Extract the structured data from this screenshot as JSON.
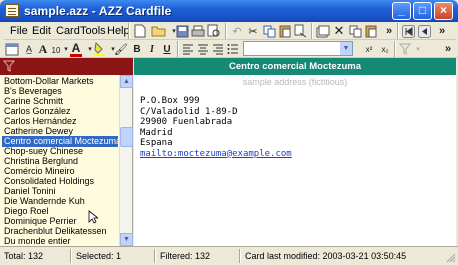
{
  "window": {
    "title": "sample.azz - AZZ Cardfile",
    "controls": {
      "minimize": "_",
      "maximize": "□",
      "close": "×"
    }
  },
  "menu": {
    "file": "File",
    "edit": "Edit",
    "card": "Card",
    "tools": "Tools",
    "help": "Help"
  },
  "toolbar": {
    "font_size_label": "10",
    "bold": "B",
    "italic": "I",
    "underline": "U",
    "superscript": "x²",
    "subscript": "x₂"
  },
  "list": {
    "items": [
      "Bottom-Dollar Markets",
      "B's Beverages",
      "Carine Schmitt",
      "Carlos González",
      "Carlos Hernández",
      "Catherine Dewey",
      "Centro comercial Moctezuma",
      "Chop-suey Chinese",
      "Christina Berglund",
      "Comércio Mineiro",
      "Consolidated Holdings",
      "Daniel Tonini",
      "Die Wandernde Kuh",
      "Diego Roel",
      "Dominique Perrier",
      "Drachenblut Delikatessen",
      "Du monde entier"
    ],
    "selected": "Centro comercial Moctezuma"
  },
  "card": {
    "title": "Centro comercial Moctezuma",
    "subtitle": "sample address (fictitious)",
    "lines": [
      "P.O.Box 999",
      "C/Valadolid 1-89-D",
      "29900 Fuenlabrada",
      "Madrid",
      "Espana"
    ],
    "link": "mailto:moctezuma@example.com"
  },
  "status": {
    "total": "Total: 132",
    "selected": "Selected: 1",
    "filtered": "Filtered: 132",
    "modified": "Card last modified: 2003-03-21  03:50:45"
  },
  "colors": {
    "title_bar": "#1f5fd6",
    "filter_bar": "#8b1515",
    "card_header": "#148a75",
    "list_bg": "#fffbdf",
    "selection": "#316ac5",
    "link": "#1c3fc7"
  }
}
